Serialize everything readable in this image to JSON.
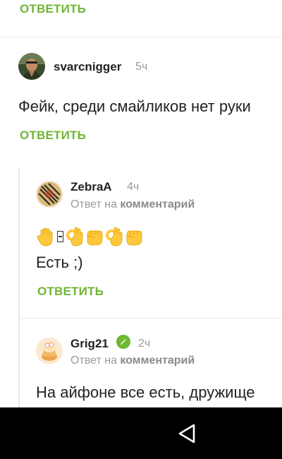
{
  "reply_label": "ОТВЕТИТЬ",
  "comments": [
    {
      "username": "svarcnigger",
      "time": "5ч",
      "text": "Фейк, среди смайликов нет руки",
      "reply_label": "ОТВЕТИТЬ"
    },
    {
      "username": "ZebraA",
      "time": "4ч",
      "reply_prefix": "Ответ на",
      "reply_link": "комментарий",
      "emojis": [
        "raised-hand-emoji",
        "missing-glyph",
        "ok-hand-emoji",
        "fist-emoji",
        "ok-hand-emoji",
        "fist-emoji"
      ],
      "text": "Есть ;)",
      "reply_label": "ОТВЕТИТЬ"
    },
    {
      "username": "Grig21",
      "verified": true,
      "time": "2ч",
      "reply_prefix": "Ответ на",
      "reply_link": "комментарий",
      "text": "На айфоне все есть, дружище"
    }
  ],
  "colors": {
    "accent": "#6fb633",
    "muted": "#9a9a9a",
    "text": "#222222",
    "navbar": "#000000"
  }
}
